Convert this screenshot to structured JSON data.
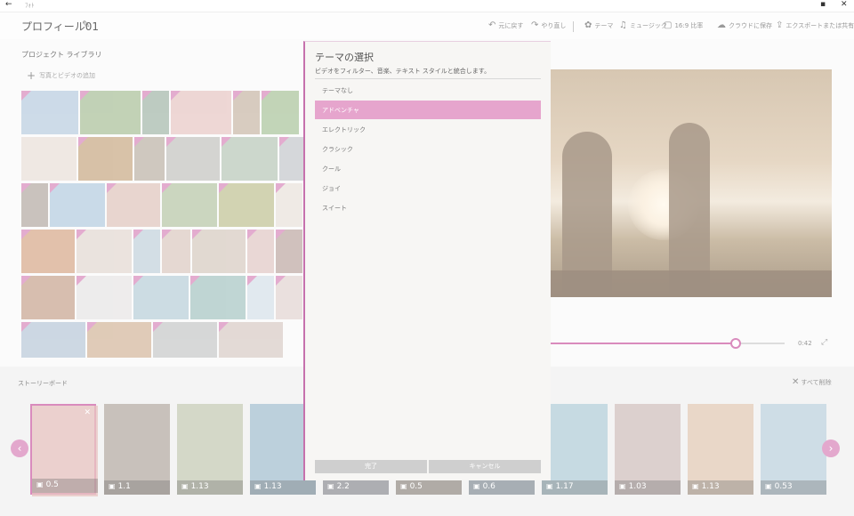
{
  "window": {
    "back_glyph": "←",
    "app_name": "ﾌｫﾄ",
    "restore_glyph": "▪",
    "close_glyph": "✕"
  },
  "header": {
    "project_title": "プロフィール01",
    "edit_icon": "pencil-icon",
    "tools": [
      {
        "icon": "undo-icon",
        "glyph": "↶",
        "label": "元に戻す"
      },
      {
        "icon": "redo-icon",
        "glyph": "↷",
        "label": "やり直し"
      },
      {
        "icon": "theme-icon",
        "glyph": "✿",
        "label": "テーマ"
      },
      {
        "icon": "music-icon",
        "glyph": "♫",
        "label": "ミュージック"
      },
      {
        "icon": "aspect-icon",
        "glyph": "▢",
        "label": "16:9 比率"
      },
      {
        "icon": "cloud-icon",
        "glyph": "☁",
        "label": "クラウドに保存"
      },
      {
        "icon": "export-icon",
        "glyph": "⇪",
        "label": "エクスポートまたは共有"
      }
    ],
    "more_glyph": "···"
  },
  "library": {
    "title": "プロジェクト ライブラリ",
    "add_label": "写真とビデオの追加"
  },
  "preview": {
    "time": "0:42",
    "progress": 0.79
  },
  "storyboard": {
    "title": "ストーリーボード",
    "delete_all": "すべて削除",
    "clips": [
      {
        "duration": "0.5",
        "selected": true,
        "color": "#e8c4c2"
      },
      {
        "duration": "1.1",
        "selected": false,
        "color": "#b9b0a8"
      },
      {
        "duration": "1.13",
        "selected": false,
        "color": "#c9cfb9"
      },
      {
        "duration": "1.13",
        "selected": false,
        "color": "#a9c4d4"
      },
      {
        "duration": "2.2",
        "selected": false,
        "color": "#c4c7cf"
      },
      {
        "duration": "0.5",
        "selected": false,
        "color": "#c9c0b6"
      },
      {
        "duration": "0.6",
        "selected": false,
        "color": "#b8c6d1"
      },
      {
        "duration": "1.17",
        "selected": false,
        "color": "#b7d2dc"
      },
      {
        "duration": "1.03",
        "selected": false,
        "color": "#d4c4c1"
      },
      {
        "duration": "1.13",
        "selected": false,
        "color": "#e6cdb9"
      },
      {
        "duration": "0.53",
        "selected": false,
        "color": "#c1d6e1"
      }
    ]
  },
  "dialog": {
    "title": "テーマの選択",
    "description": "ビデオをフィルター、音楽、テキスト スタイルと統合します。",
    "options": [
      "テーマなし",
      "アドベンチャ",
      "エレクトリック",
      "クラシック",
      "クール",
      "ジョイ",
      "スイート"
    ],
    "selected_index": 1,
    "ok_label": "完了",
    "cancel_label": "キャンセル"
  },
  "colors": {
    "accent": "#c671ad",
    "accent_light": "#e6a5cd"
  }
}
